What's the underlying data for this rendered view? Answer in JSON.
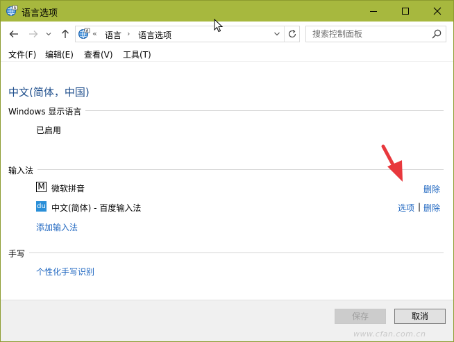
{
  "window": {
    "title": "语言选项",
    "accent_color": "#a7b83e",
    "minimize_icon": "minimize-icon",
    "maximize_icon": "maximize-icon",
    "close_icon": "close-icon"
  },
  "address": {
    "overflow": "«",
    "crumbs": [
      "语言",
      "语言选项"
    ],
    "separator": "›"
  },
  "search": {
    "placeholder": "搜索控制面板"
  },
  "menu": [
    "文件(F)",
    "编辑(E)",
    "查看(V)",
    "工具(T)"
  ],
  "content": {
    "language_title": "中文(简体，中国)",
    "display_section": {
      "heading": "Windows 显示语言",
      "status": "已启用"
    },
    "ime_section": {
      "heading": "输入法",
      "items": [
        {
          "icon_text": "M",
          "label": "微软拼音",
          "actions": [
            "删除"
          ]
        },
        {
          "icon_text": "du",
          "label": "中文(简体) - 百度输入法",
          "actions": [
            "选项",
            "删除"
          ]
        }
      ],
      "action_separator": "|",
      "add_link": "添加输入法"
    },
    "handwriting_section": {
      "heading": "手写",
      "link": "个性化手写识别"
    }
  },
  "footer": {
    "save_label": "保存",
    "cancel_label": "取消",
    "watermark": "www.cfan.com.cn"
  },
  "colors": {
    "link": "#1e66c0",
    "title_blue": "#1e4e8c",
    "annotation_arrow": "#e8383d"
  }
}
